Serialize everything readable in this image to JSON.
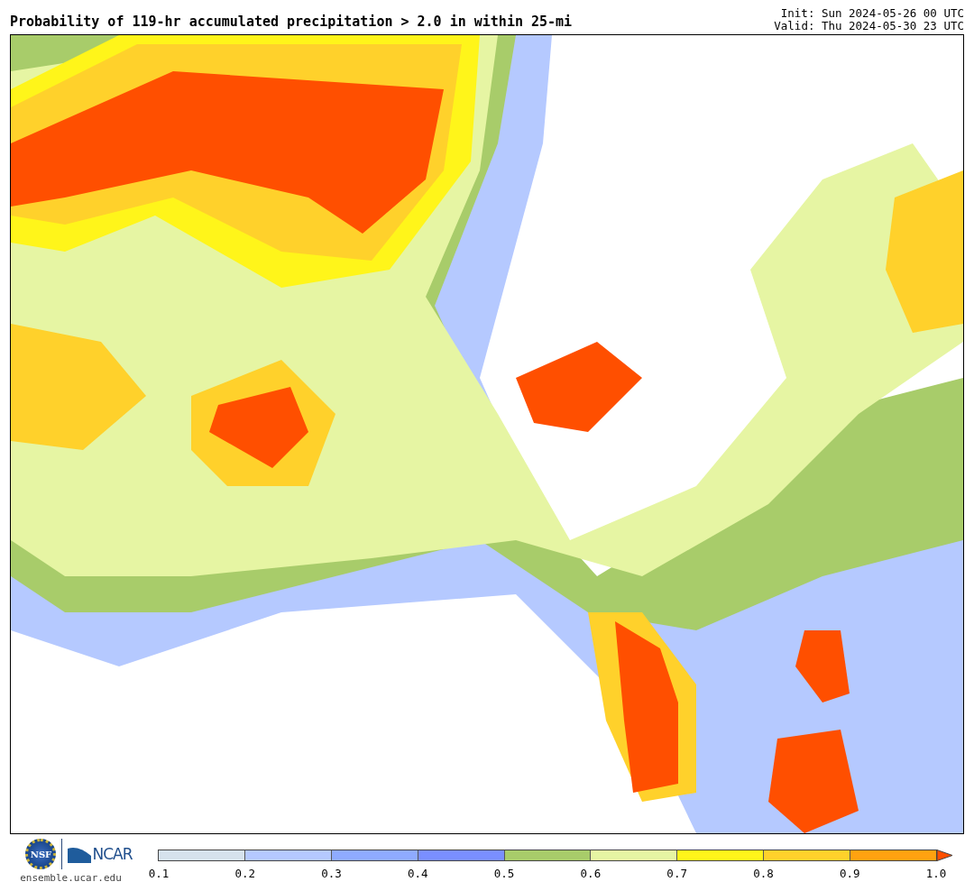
{
  "header": {
    "title": "Probability of 119-hr accumulated precipitation > 2.0 in within 25-mi",
    "init": "Init: Sun 2024-05-26 00 UTC",
    "valid": "Valid: Thu 2024-05-30 23 UTC"
  },
  "footer": {
    "nsf_logo_text": "NSF",
    "ncar_logo_text": "NCAR",
    "website": "ensemble.ucar.edu"
  },
  "colorbar": {
    "bins": [
      {
        "color": "#d6e2ed"
      },
      {
        "color": "#b5c9ff"
      },
      {
        "color": "#8fabff"
      },
      {
        "color": "#7a8fff"
      },
      {
        "color": "#a8cc6a"
      },
      {
        "color": "#e6f5a3"
      },
      {
        "color": "#fff51a"
      },
      {
        "color": "#ffd12b"
      },
      {
        "color": "#ffa210"
      }
    ],
    "extend": {
      "color": "#ff4f00"
    },
    "ticks": [
      "0.1",
      "0.2",
      "0.3",
      "0.4",
      "0.5",
      "0.6",
      "0.7",
      "0.8",
      "0.9",
      "1.0"
    ]
  }
}
